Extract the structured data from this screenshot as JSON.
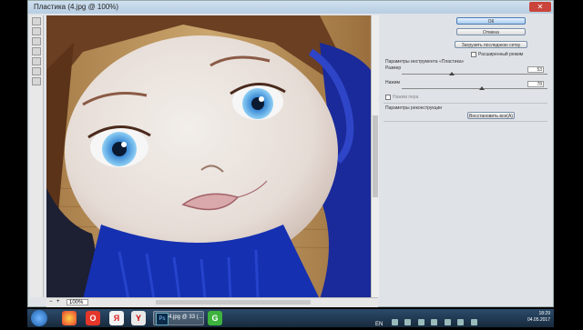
{
  "window": {
    "title": "Пластика (4.jpg @ 100%)",
    "close_label": "✕"
  },
  "tools": [
    "warp-tool",
    "reconstruct-tool",
    "pucker-tool",
    "bloat-tool",
    "push-left-tool",
    "hand-tool",
    "zoom-tool"
  ],
  "status": {
    "zoom": "100%"
  },
  "panel": {
    "ok_label": "ОК",
    "cancel_label": "Отмена",
    "load_last_label": "Загрузить последнюю сетку",
    "advanced_mode_label": "Расширенный режим",
    "tool_options_title": "Параметры инструмента «Пластика»",
    "brush_size_label": "Размер",
    "brush_size_value": "53",
    "pressure_label": "Нажим",
    "pressure_value": "78",
    "stylus_label": "Нажим пера",
    "reconstruct_title": "Параметры реконструкции",
    "restore_all_label": "Восстановить все(А)"
  },
  "taskbar": {
    "ps_label": "4.jpg @ 33 (...",
    "time": "18:29",
    "date": "04.05.2017",
    "lang": "EN"
  }
}
